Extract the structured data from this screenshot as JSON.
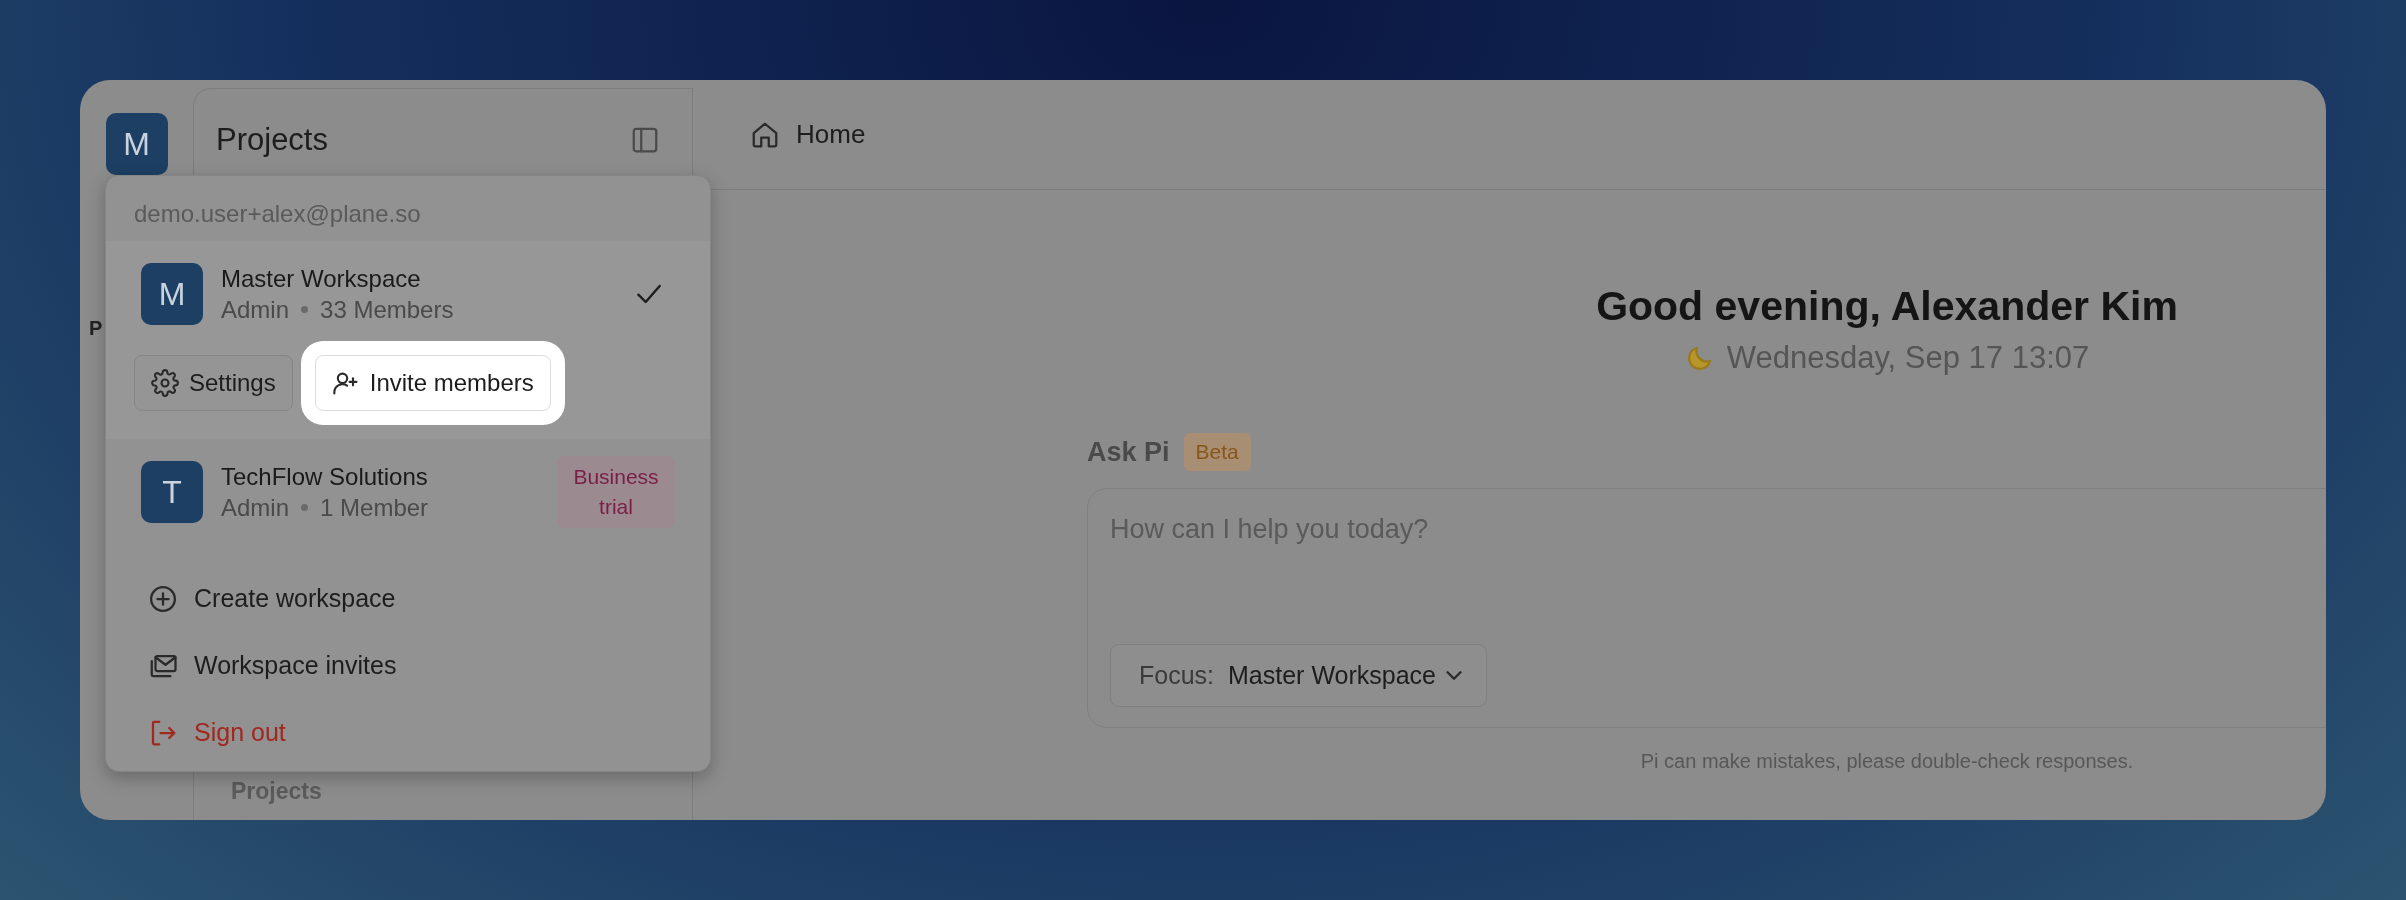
{
  "sidebar": {
    "workspace_initial": "M",
    "title": "Projects",
    "partial_label": "P",
    "section_label": "Projects"
  },
  "header": {
    "breadcrumb": "Home"
  },
  "workspace_menu": {
    "email": "demo.user+alex@plane.so",
    "workspaces": [
      {
        "initial": "M",
        "name": "Master Workspace",
        "role": "Admin",
        "members": "33 Members",
        "selected": true,
        "actions": [
          {
            "kind": "settings",
            "label": "Settings",
            "highlighted": false
          },
          {
            "kind": "invite",
            "label": "Invite members",
            "highlighted": true
          }
        ]
      },
      {
        "initial": "T",
        "name": "TechFlow Solutions",
        "role": "Admin",
        "members": "1 Member",
        "selected": false,
        "badge": "Business trial"
      }
    ],
    "items": [
      {
        "kind": "create",
        "label": "Create workspace"
      },
      {
        "kind": "invites",
        "label": "Workspace invites"
      },
      {
        "kind": "signout",
        "label": "Sign out"
      }
    ]
  },
  "home": {
    "greeting": "Good evening, Alexander Kim",
    "date": "Wednesday, Sep 17 13:07",
    "ask": {
      "title": "Ask Pi",
      "badge": "Beta",
      "placeholder": "How can I help you today?",
      "focus_label": "Focus:",
      "focus_value": "Master Workspace"
    },
    "disclaimer": "Pi can make mistakes, please double-check responses."
  }
}
